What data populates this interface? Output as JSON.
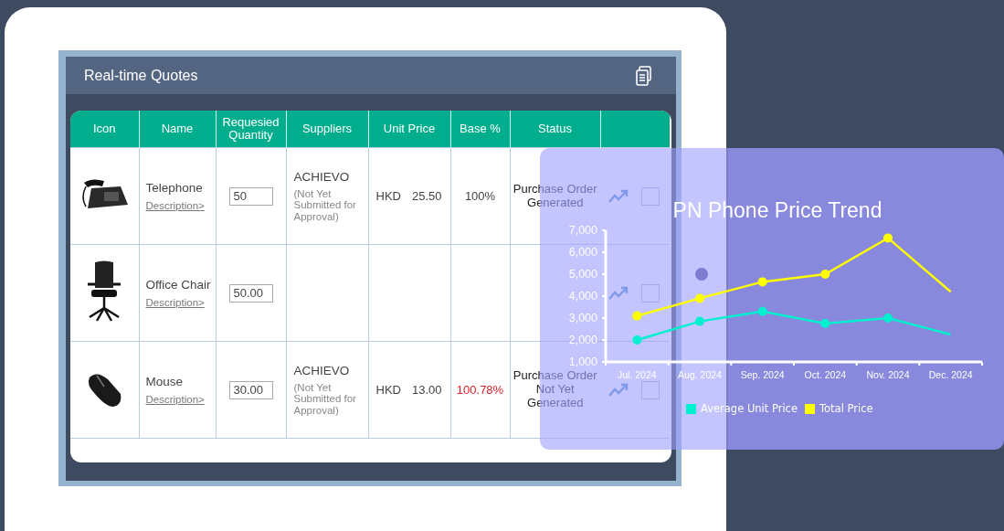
{
  "header": {
    "title": "Real-time Quotes"
  },
  "table": {
    "columns": [
      "Icon",
      "Name",
      "Requesied Quantity",
      "Suppliers",
      "Unit Price",
      "Base %",
      "Status"
    ],
    "rows": [
      {
        "kind": "telephone",
        "name": "Telephone",
        "link": "Description>",
        "quantity": "50",
        "supplier": "ACHIEVO",
        "supplier_note": "(Not Yet Submitted for Approval)",
        "currency": "HKD",
        "price": "25.50",
        "base": "100%",
        "base_alert": false,
        "status": "Purchase Order Generated",
        "checked": false
      },
      {
        "kind": "chair",
        "name": "Office Chair",
        "link": "Description>",
        "quantity": "50.00",
        "checked": false
      },
      {
        "kind": "mouse",
        "name": "Mouse",
        "link": "Description>",
        "quantity": "30.00",
        "supplier": "ACHIEVO",
        "supplier_note": "(Not Yet Submitted for Approval)",
        "currency": "HKD",
        "price": "13.00",
        "base": "100.78%",
        "base_alert": true,
        "status": "Purchase Order Not Yet Generated",
        "checked": false
      }
    ]
  },
  "chart": {
    "chart_data": {
      "type": "line",
      "title": "PN Phone Price Trend",
      "categories": [
        "Jul. 2024",
        "Aug. 2024",
        "Sep. 2024",
        "Oct. 2024",
        "Nov. 2024",
        "Dec. 2024"
      ],
      "series": [
        {
          "name": "Average Unit Price",
          "color": "#00f0d0",
          "marker": "circle",
          "values": [
            2000,
            2850,
            3300,
            2750,
            3000,
            2250
          ]
        },
        {
          "name": "Total Price",
          "color": "#ffff00",
          "marker": "circle",
          "values": [
            3100,
            3900,
            4650,
            5000,
            6650,
            4200
          ]
        }
      ],
      "legend": "bottom",
      "ylim": [
        1000,
        7000
      ],
      "yticks": [
        {
          "value": 1000,
          "label": "1,000"
        },
        {
          "value": 2000,
          "label": "2,000"
        },
        {
          "value": 3000,
          "label": "3,000"
        },
        {
          "value": 4000,
          "label": "4,000"
        },
        {
          "value": 5000,
          "label": "5,000"
        },
        {
          "value": 6000,
          "label": "6,000"
        },
        {
          "value": 7000,
          "label": "7,000"
        }
      ]
    }
  }
}
